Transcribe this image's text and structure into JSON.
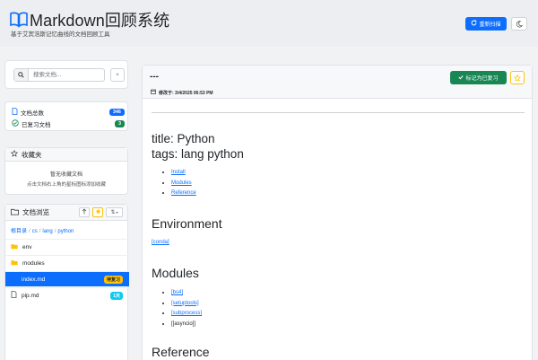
{
  "app": {
    "title": "Markdown回顾系统",
    "subtitle": "基于艾宾浩斯记忆曲线的文档回顾工具",
    "refresh_label": "重新扫描",
    "colors": {
      "primary": "#0d6efd",
      "success": "#198754",
      "warning": "#ffc107",
      "info": "#0dcaf0",
      "dark": "#212529"
    }
  },
  "search": {
    "placeholder": "搜索文档...",
    "clear_label": "×"
  },
  "stats": {
    "total_label": "文档总数",
    "total_value": "346",
    "reviewed_label": "已复习文档",
    "reviewed_value": "3"
  },
  "favorites": {
    "title": "收藏夹",
    "empty_text": "暂无收藏文档",
    "hint_text": "点击文档右上角的星标图标添加收藏"
  },
  "browser": {
    "title": "文档浏览",
    "sort_label": "⇅",
    "breadcrumb": [
      "根目录",
      "cs",
      "lang",
      "python"
    ],
    "items": [
      {
        "name": "env",
        "type": "folder",
        "badge": ""
      },
      {
        "name": "modules",
        "type": "folder",
        "badge": ""
      },
      {
        "name": "index.md",
        "type": "file",
        "badge": "待复习",
        "active": true
      },
      {
        "name": "pip.md",
        "type": "file",
        "badge": "1天"
      }
    ]
  },
  "document": {
    "title": "---",
    "modified": "修改于: 3/4/2025 06:53 PM",
    "mark_label": "标记为已复习",
    "frontmatter": [
      "title: Python",
      "tags: lang python"
    ],
    "toc": [
      "Install",
      "Modules",
      "Reference"
    ],
    "sections": [
      {
        "heading": "Environment",
        "items": [
          "[conda]"
        ]
      },
      {
        "heading": "Modules",
        "items": [
          "[bs4]",
          "[setuptools]",
          "[subprocess]",
          "[[asyncio]]"
        ]
      },
      {
        "heading": "Reference",
        "items": []
      }
    ]
  }
}
